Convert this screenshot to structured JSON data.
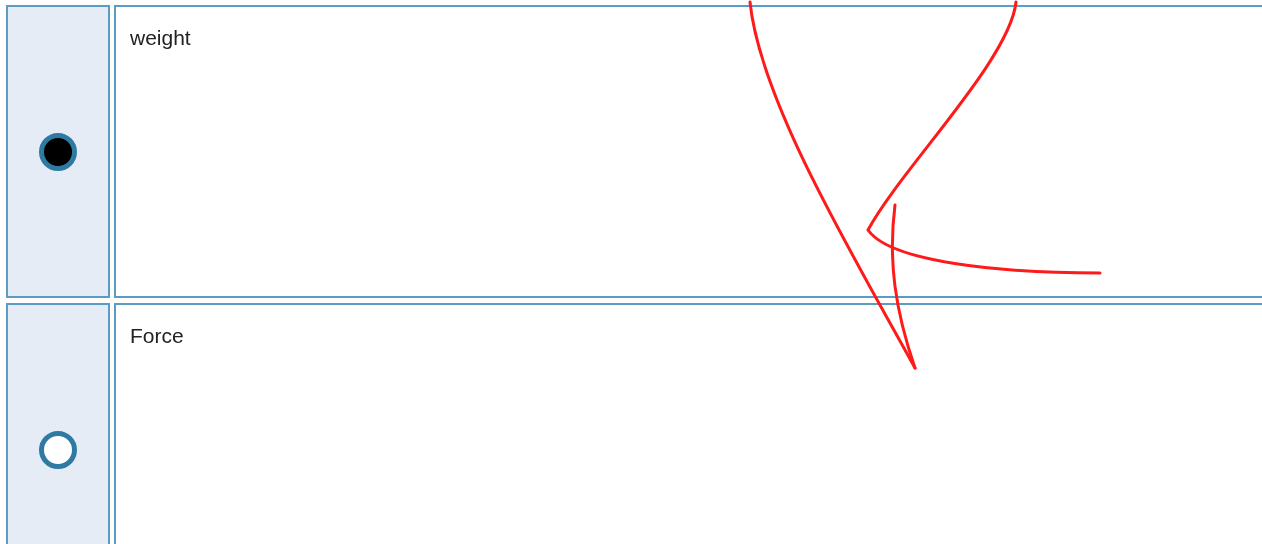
{
  "options": [
    {
      "label": "weight",
      "selected": true
    },
    {
      "label": "Force",
      "selected": false
    }
  ]
}
